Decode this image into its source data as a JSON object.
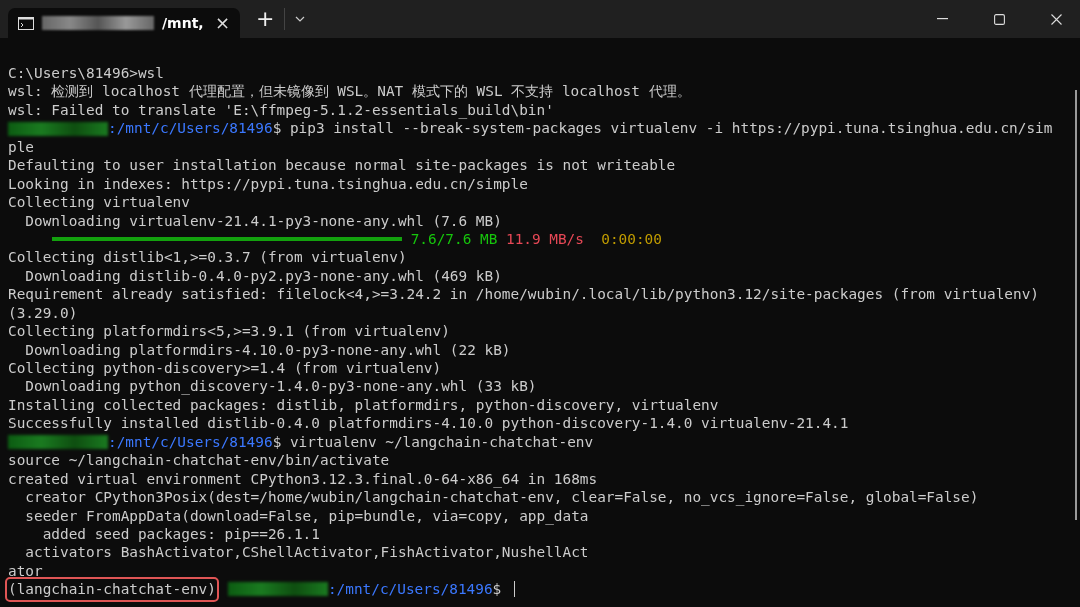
{
  "tab": {
    "title": "/mnt,",
    "selected": true,
    "close": "×"
  },
  "new_tab": "+",
  "lines": [
    {
      "segments": [
        {
          "kind": "text",
          "text": "C:\\Users\\81496>wsl"
        }
      ]
    },
    {
      "segments": [
        {
          "kind": "text",
          "text": "wsl: 检测到 localhost 代理配置，但未镜像到 WSL。NAT 模式下的 WSL 不支持 localhost 代理。"
        }
      ]
    },
    {
      "segments": [
        {
          "kind": "text",
          "text": "wsl: Failed to translate 'E:\\ffmpeg-5.1.2-essentials_build\\bin'"
        }
      ]
    },
    {
      "segments": [
        {
          "kind": "redacted"
        },
        {
          "kind": "path",
          "text": ":/mnt/c/Users/81496"
        },
        {
          "kind": "text",
          "text": "$ pip3 install --break-system-packages virtualenv -i https://pypi.tuna.tsinghua.edu.cn/sim"
        }
      ]
    },
    {
      "segments": [
        {
          "kind": "text",
          "text": "ple"
        }
      ]
    },
    {
      "segments": [
        {
          "kind": "text",
          "text": "Defaulting to user installation because normal site-packages is not writeable"
        }
      ]
    },
    {
      "segments": [
        {
          "kind": "text",
          "text": "Looking in indexes: https://pypi.tuna.tsinghua.edu.cn/simple"
        }
      ]
    },
    {
      "segments": [
        {
          "kind": "text",
          "text": "Collecting virtualenv"
        }
      ]
    },
    {
      "segments": [
        {
          "kind": "text",
          "text": "  Downloading virtualenv-21.4.1-py3-none-any.whl (7.6 MB)"
        }
      ]
    },
    {
      "segments": [
        {
          "kind": "bar",
          "level": 1
        },
        {
          "kind": "green",
          "text": " 7.6/7.6 MB"
        },
        {
          "kind": "red",
          "text": " 11.9 MB/s"
        },
        {
          "kind": "yellow",
          "text": "  0:00:00"
        }
      ]
    },
    {
      "segments": [
        {
          "kind": "text",
          "text": "Collecting distlib<1,>=0.3.7 (from virtualenv)"
        }
      ]
    },
    {
      "segments": [
        {
          "kind": "text",
          "text": "  Downloading distlib-0.4.0-py2.py3-none-any.whl (469 kB)"
        }
      ]
    },
    {
      "segments": [
        {
          "kind": "text",
          "text": "Requirement already satisfied: filelock<4,>=3.24.2 in /home/wubin/.local/lib/python3.12/site-packages (from virtualenv)"
        }
      ]
    },
    {
      "segments": [
        {
          "kind": "text",
          "text": "(3.29.0)"
        }
      ]
    },
    {
      "segments": [
        {
          "kind": "text",
          "text": "Collecting platformdirs<5,>=3.9.1 (from virtualenv)"
        }
      ]
    },
    {
      "segments": [
        {
          "kind": "text",
          "text": "  Downloading platformdirs-4.10.0-py3-none-any.whl (22 kB)"
        }
      ]
    },
    {
      "segments": [
        {
          "kind": "text",
          "text": "Collecting python-discovery>=1.4 (from virtualenv)"
        }
      ]
    },
    {
      "segments": [
        {
          "kind": "text",
          "text": "  Downloading python_discovery-1.4.0-py3-none-any.whl (33 kB)"
        }
      ]
    },
    {
      "segments": [
        {
          "kind": "text",
          "text": "Installing collected packages: distlib, platformdirs, python-discovery, virtualenv"
        }
      ]
    },
    {
      "segments": [
        {
          "kind": "text",
          "text": "Successfully installed distlib-0.4.0 platformdirs-4.10.0 python-discovery-1.4.0 virtualenv-21.4.1"
        }
      ]
    },
    {
      "segments": [
        {
          "kind": "redacted"
        },
        {
          "kind": "path",
          "text": ":/mnt/c/Users/81496"
        },
        {
          "kind": "text",
          "text": "$ virtualenv ~/langchain-chatchat-env"
        }
      ]
    },
    {
      "segments": [
        {
          "kind": "text",
          "text": "source ~/langchain-chatchat-env/bin/activate"
        }
      ]
    },
    {
      "segments": [
        {
          "kind": "text",
          "text": "created virtual environment CPython3.12.3.final.0-64-x86_64 in 168ms"
        }
      ]
    },
    {
      "segments": [
        {
          "kind": "text",
          "text": "  creator CPython3Posix(dest=/home/wubin/langchain-chatchat-env, clear=False, no_vcs_ignore=False, global=False)"
        }
      ]
    },
    {
      "segments": [
        {
          "kind": "text",
          "text": "  seeder FromAppData(download=False, pip=bundle, via=copy, app_data"
        }
      ]
    },
    {
      "segments": [
        {
          "kind": "text",
          "text": "    added seed packages: pip==26.1.1"
        }
      ]
    },
    {
      "segments": [
        {
          "kind": "text",
          "text": "  activators BashActivator,CShellActivator,FishActivator,NushellAct"
        }
      ]
    },
    {
      "segments": [
        {
          "kind": "text",
          "text": "ator"
        }
      ]
    },
    {
      "segments": [
        {
          "kind": "boxed",
          "text": "(langchain-chatchat-env)"
        },
        {
          "kind": "redacted"
        },
        {
          "kind": "path",
          "text": ":/mnt/c/Users/81496"
        },
        {
          "kind": "text",
          "text": "$ "
        },
        {
          "kind": "cursor"
        }
      ]
    }
  ]
}
